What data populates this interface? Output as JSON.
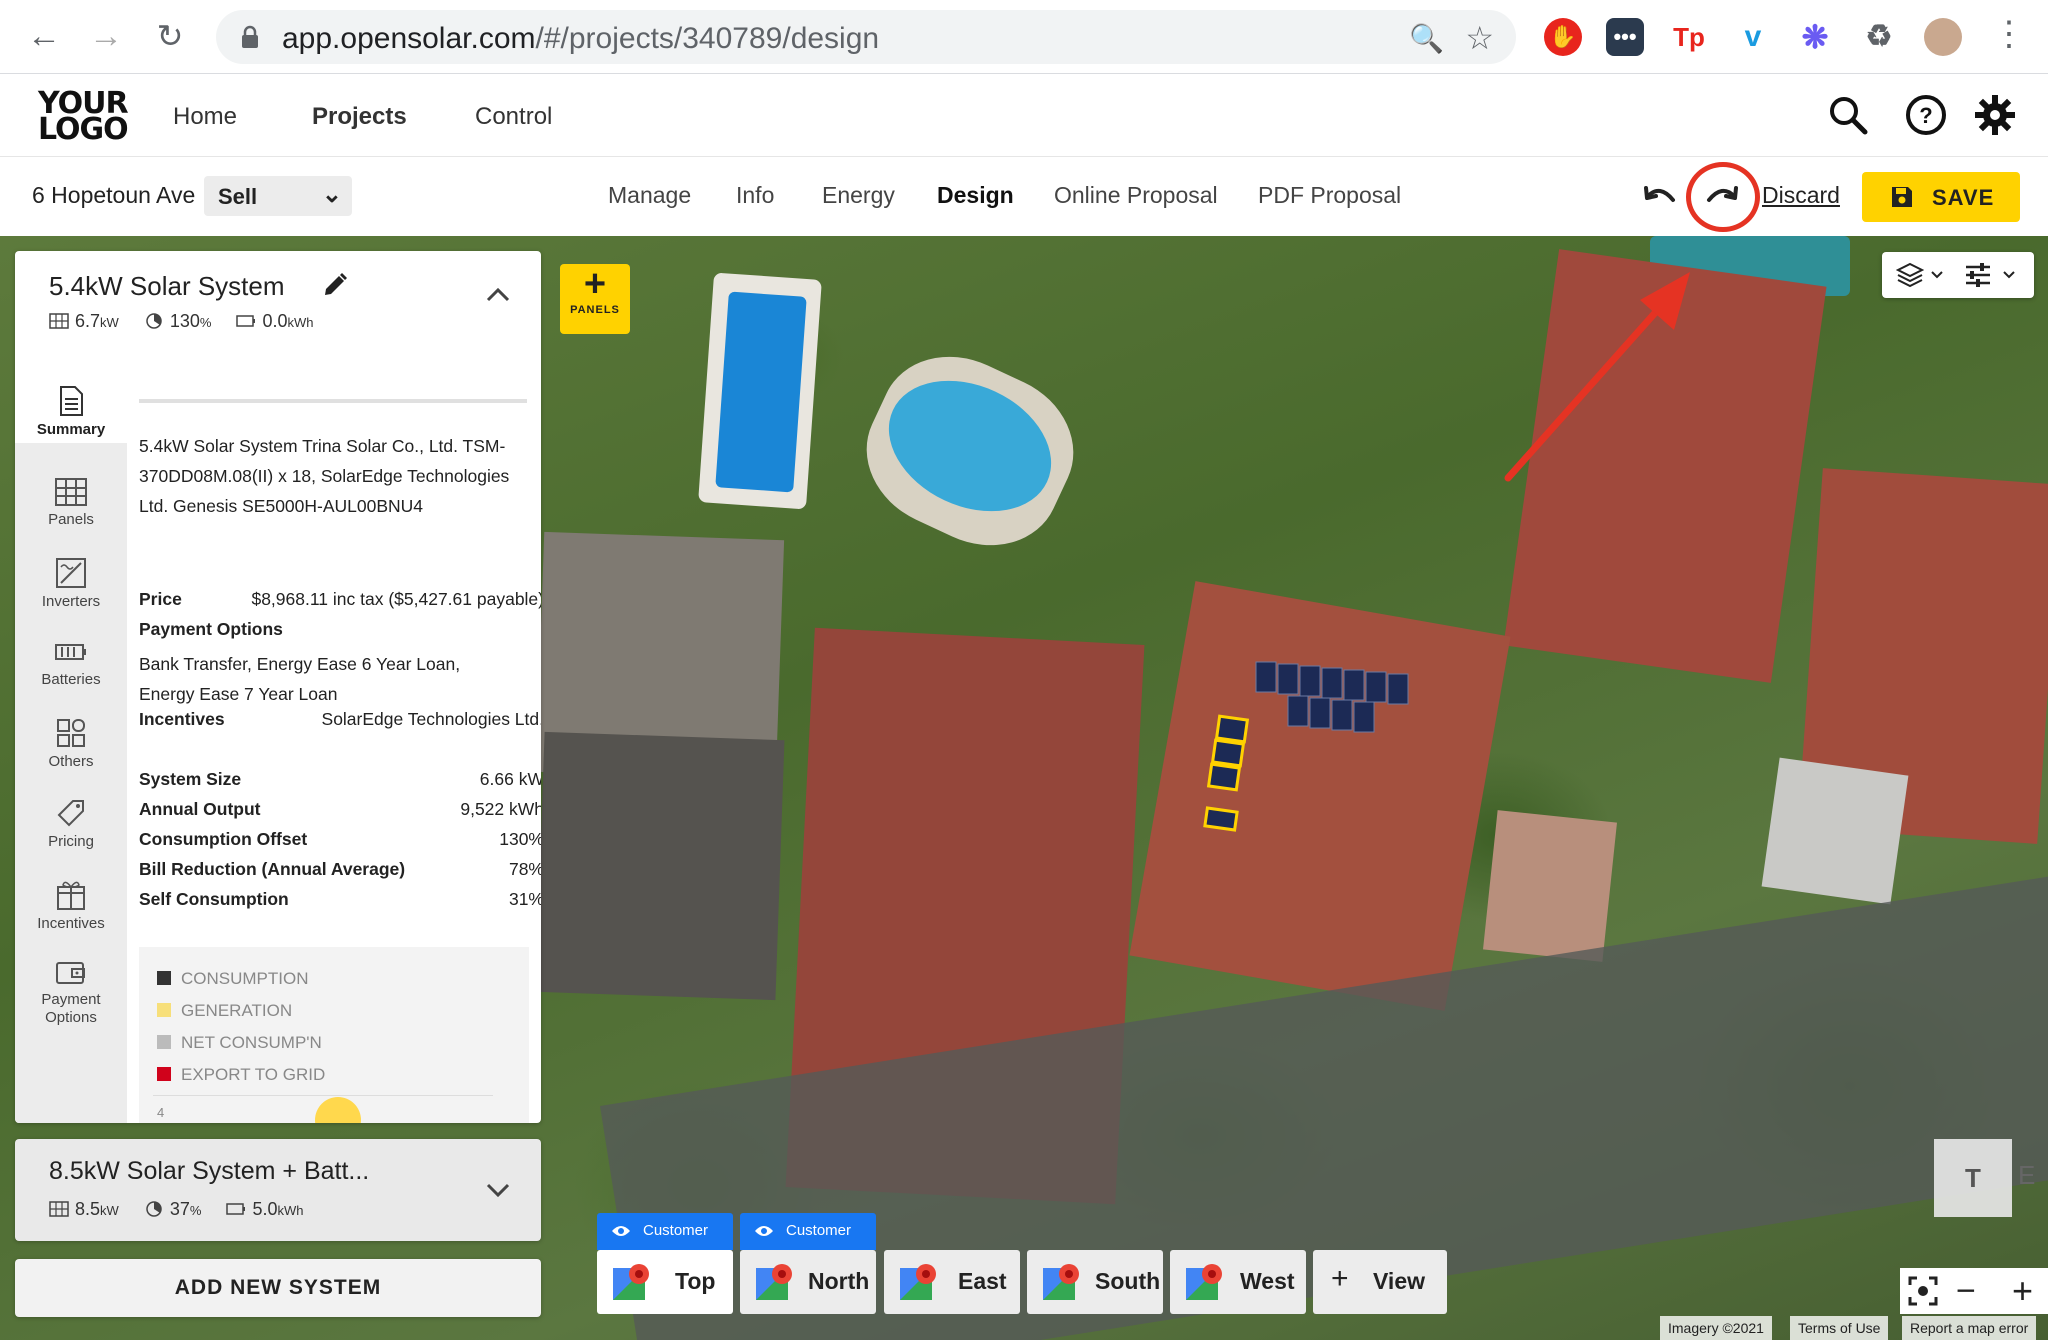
{
  "browser": {
    "url_host": "app.opensolar.com",
    "url_path": "/#/projects/340789/design"
  },
  "app": {
    "logo_line1": "YOUR",
    "logo_line2": "LOGO",
    "nav": [
      "Home",
      "Projects",
      "Control"
    ]
  },
  "project": {
    "address": "6 Hopetoun Ave",
    "mode": "Sell",
    "tabs": [
      "Manage",
      "Info",
      "Energy",
      "Design",
      "Online Proposal",
      "PDF Proposal"
    ],
    "discard_label": "Discard",
    "save_label": "SAVE"
  },
  "system1": {
    "title": "5.4kW Solar System",
    "size_value": "6.7",
    "size_unit": "kW",
    "offset_value": "130",
    "offset_unit": "%",
    "battery_value": "0.0",
    "battery_unit": "kWh",
    "description": "5.4kW Solar System Trina Solar Co., Ltd. TSM-370DD08M.08(II) x 18, SolarEdge Technologies Ltd. Genesis SE5000H-AUL00BNU4",
    "price_label": "Price",
    "price_value": "$8,968.11 inc tax ($5,427.61 payable)",
    "payment_label": "Payment Options",
    "payment_value": "Bank Transfer, Energy Ease 6 Year Loan, Energy Ease 7 Year Loan",
    "incentives_label": "Incentives",
    "incentives_value": "SolarEdge Technologies Ltd.",
    "metrics": [
      {
        "label": "System Size",
        "value": "6.66 kW"
      },
      {
        "label": "Annual Output",
        "value": "9,522 kWh"
      },
      {
        "label": "Consumption Offset",
        "value": "130%"
      },
      {
        "label": "Bill Reduction (Annual Average)",
        "value": "78%"
      },
      {
        "label": "Self Consumption",
        "value": "31%"
      }
    ],
    "legend": [
      {
        "label": "CONSUMPTION",
        "color": "#333333"
      },
      {
        "label": "GENERATION",
        "color": "#f7df7a"
      },
      {
        "label": "NET CONSUMP'N",
        "color": "#bbbbbb"
      },
      {
        "label": "EXPORT TO GRID",
        "color": "#d0021b"
      }
    ],
    "chart_tick": "4"
  },
  "sidebar": [
    {
      "label": "Summary"
    },
    {
      "label": "Panels"
    },
    {
      "label": "Inverters"
    },
    {
      "label": "Batteries"
    },
    {
      "label": "Others"
    },
    {
      "label": "Pricing"
    },
    {
      "label": "Incentives"
    },
    {
      "label": "Payment Options"
    }
  ],
  "system2": {
    "title": "8.5kW Solar System + Batt...",
    "size_value": "8.5",
    "size_unit": "kW",
    "offset_value": "37",
    "offset_unit": "%",
    "battery_value": "5.0",
    "battery_unit": "kWh"
  },
  "add_system_label": "ADD NEW SYSTEM",
  "map": {
    "panels_label": "PANELS",
    "views": [
      "Top",
      "North",
      "East",
      "South",
      "West",
      "View"
    ],
    "customer_tag": "Customer",
    "t_label": "T",
    "t_partial": "E",
    "attribution": [
      "Imagery ©2021",
      "Terms of Use",
      "Report a map error"
    ]
  },
  "colors": {
    "accent": "#ffd200",
    "annotation": "#e53323",
    "customer": "#1877f2"
  }
}
